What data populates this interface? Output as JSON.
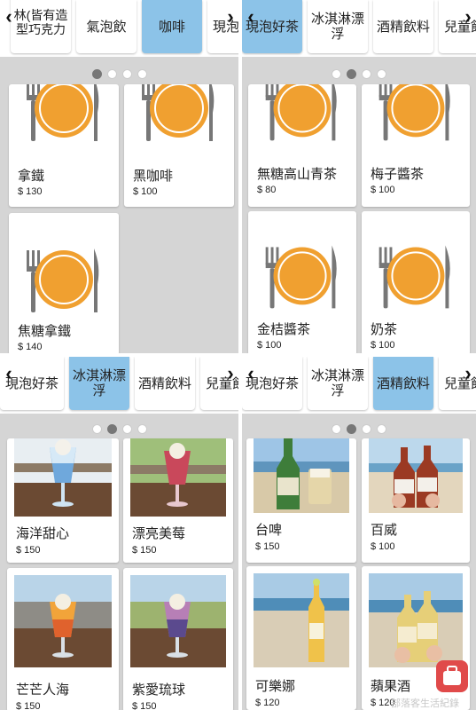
{
  "panels": [
    {
      "tabs": [
        "林(皆有造型巧克力",
        "氣泡飲",
        "咖啡",
        "現泡"
      ],
      "active_tab": 2,
      "items": [
        {
          "name": "拿鐵",
          "price": "$ 130"
        },
        {
          "name": "黑咖啡",
          "price": "$ 100"
        },
        {
          "name": "焦糖拿鐵",
          "price": "$ 140"
        }
      ]
    },
    {
      "tabs": [
        "現泡好茶",
        "冰淇淋漂浮",
        "酒精飲料",
        "兒童飲"
      ],
      "active_tab": 0,
      "items": [
        {
          "name": "無糖高山青茶",
          "price": "$ 80"
        },
        {
          "name": "梅子醬茶",
          "price": "$ 100"
        },
        {
          "name": "金桔醬茶",
          "price": "$ 100"
        },
        {
          "name": "奶茶",
          "price": "$ 100"
        }
      ]
    },
    {
      "tabs": [
        "現泡好茶",
        "冰淇淋漂浮",
        "酒精飲料",
        "兒童飲"
      ],
      "active_tab": 1,
      "items": [
        {
          "name": "海洋甜心",
          "price": "$ 150"
        },
        {
          "name": "漂亮美莓",
          "price": "$ 150"
        },
        {
          "name": "芒芒人海",
          "price": "$ 150"
        },
        {
          "name": "紫愛琉球",
          "price": "$ 150"
        }
      ]
    },
    {
      "tabs": [
        "現泡好茶",
        "冰淇淋漂浮",
        "酒精飲料",
        "兒童飲"
      ],
      "active_tab": 2,
      "items": [
        {
          "name": "台啤",
          "price": "$ 150"
        },
        {
          "name": "百威",
          "price": "$ 100"
        },
        {
          "name": "可樂娜",
          "price": "$ 120"
        },
        {
          "name": "蘋果酒",
          "price": "$ 120"
        }
      ]
    }
  ],
  "watermark": "部落客生活紀錄",
  "colors": {
    "active_tab": "#8cc3e8",
    "plate": "#f0a030",
    "background": "#d5d5d5"
  }
}
